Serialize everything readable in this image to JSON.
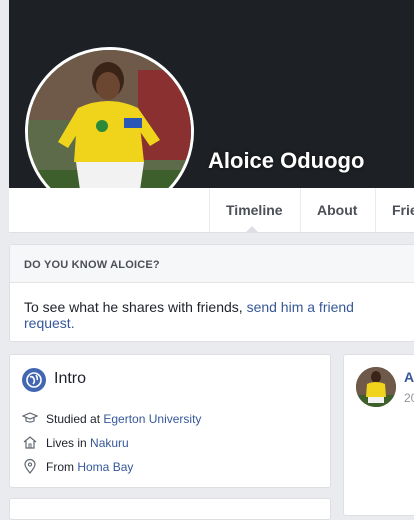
{
  "profile": {
    "name": "Aloice Oduogo"
  },
  "tabs": [
    {
      "label": "Timeline"
    },
    {
      "label": "About"
    },
    {
      "label": "Friends"
    }
  ],
  "know": {
    "heading": "DO YOU KNOW ALOICE?",
    "text": "To see what he shares with friends, ",
    "link": "send him a friend request."
  },
  "intro": {
    "title": "Intro",
    "items": [
      {
        "icon": "graduation-cap-icon",
        "prefix": "Studied at ",
        "value": "Egerton University"
      },
      {
        "icon": "home-icon",
        "prefix": "Lives in ",
        "value": "Nakuru"
      },
      {
        "icon": "location-pin-icon",
        "prefix": "From ",
        "value": "Homa Bay"
      }
    ]
  },
  "post": {
    "author_initial": "A",
    "date_prefix": "20"
  },
  "colors": {
    "link": "#365899",
    "cover": "#1d2024",
    "background": "#e9ebee"
  }
}
